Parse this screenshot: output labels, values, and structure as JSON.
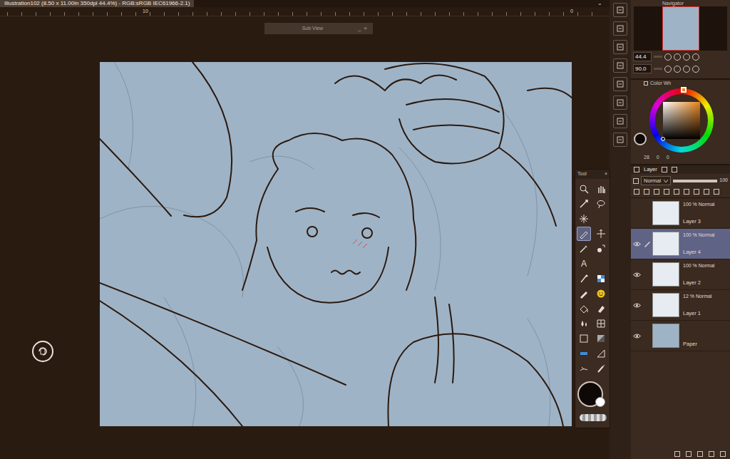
{
  "window": {
    "title": "Illustration102 (8.50 x 11.00in 350dpi 44.4%) - RGB:sRGB IEC61966-2.1)",
    "menu_glyph": "⌄"
  },
  "ruler": {
    "labels": [
      "10",
      "0"
    ]
  },
  "sub_view": {
    "title": "Sub View",
    "minimize": "_",
    "close": "×"
  },
  "tool_palette": {
    "title": "Tool",
    "close": "×",
    "tools": [
      {
        "selected": false
      },
      {
        "selected": false
      },
      {
        "selected": false
      },
      {
        "selected": false
      },
      {
        "selected": false
      },
      {
        "selected": false
      },
      {
        "selected": true
      },
      {
        "selected": false
      },
      {
        "selected": false
      },
      {
        "selected": false
      },
      {
        "selected": false,
        "glyph": "A"
      },
      {
        "selected": false
      },
      {
        "selected": false
      },
      {
        "selected": false
      },
      {
        "selected": false
      },
      {
        "selected": false
      },
      {
        "selected": false
      },
      {
        "selected": false
      },
      {
        "selected": false
      },
      {
        "selected": false
      },
      {
        "selected": false
      },
      {
        "selected": false
      },
      {
        "selected": false
      },
      {
        "selected": false
      },
      {
        "selected": false
      },
      {
        "selected": false
      }
    ]
  },
  "navigator": {
    "title": "Navigator",
    "zoom": "44.4",
    "rotation": "90.0"
  },
  "color_wheel": {
    "title": "Color Wh",
    "readings": [
      "28",
      "0",
      "0"
    ]
  },
  "layer_panel": {
    "tab": "Layer",
    "blend_mode": "Normal",
    "opacity": "100",
    "opacity_level": 1.0,
    "layers": [
      {
        "name": "Layer 3",
        "mode": "100 % Normal",
        "visible": false,
        "editing": false,
        "selected": false,
        "kind": "raster"
      },
      {
        "name": "Layer 4",
        "mode": "100 % Normal",
        "visible": true,
        "editing": true,
        "selected": true,
        "kind": "raster"
      },
      {
        "name": "Layer 2",
        "mode": "100 % Normal",
        "visible": true,
        "editing": false,
        "selected": false,
        "kind": "raster"
      },
      {
        "name": "Layer 1",
        "mode": "12 % Normal",
        "visible": true,
        "editing": false,
        "selected": false,
        "kind": "raster"
      },
      {
        "name": "Paper",
        "mode": "",
        "visible": true,
        "editing": false,
        "selected": false,
        "kind": "paper"
      }
    ]
  }
}
